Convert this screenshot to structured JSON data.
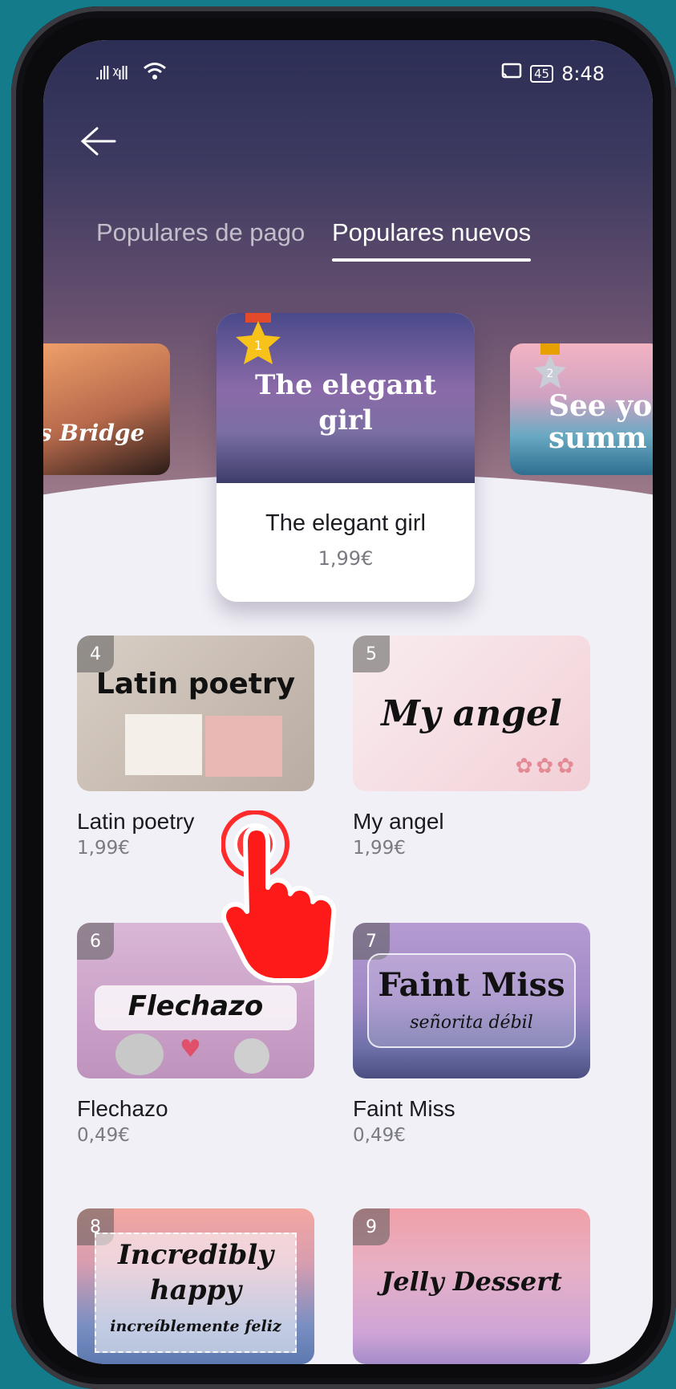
{
  "status": {
    "signal": ".ıll ᵡıll",
    "battery": "45",
    "time": "8:48"
  },
  "tabs": [
    {
      "label": "Populares de pago",
      "active": false
    },
    {
      "label": "Populares nuevos",
      "active": true
    }
  ],
  "carousel": {
    "left": {
      "title": "rs Bridge"
    },
    "featured": {
      "rank": "1",
      "cover_title": "The elegant girl",
      "name": "The elegant girl",
      "price": "1,99€"
    },
    "right": {
      "rank": "2",
      "cover_title": "See yo summ"
    }
  },
  "grid": [
    {
      "rank": "4",
      "cover": "Latin poetry",
      "name": "Latin poetry",
      "price": "1,99€"
    },
    {
      "rank": "5",
      "cover": "My angel",
      "name": "My angel",
      "price": "1,99€"
    },
    {
      "rank": "6",
      "cover": "Flechazo",
      "name": "Flechazo",
      "price": "0,49€"
    },
    {
      "rank": "7",
      "cover": "Faint Miss",
      "cover_sub": "señorita débil",
      "name": "Faint Miss",
      "price": "0,49€"
    },
    {
      "rank": "8",
      "cover": "Incredibly happy",
      "cover_sub": "increíblemente feliz"
    },
    {
      "rank": "9",
      "cover": "Jelly Dessert"
    }
  ],
  "colors": {
    "accent_bg": "#137b8a",
    "header_top": "#2c2e55",
    "medal_gold": "#f5b400",
    "hand_red": "#ff2020"
  }
}
